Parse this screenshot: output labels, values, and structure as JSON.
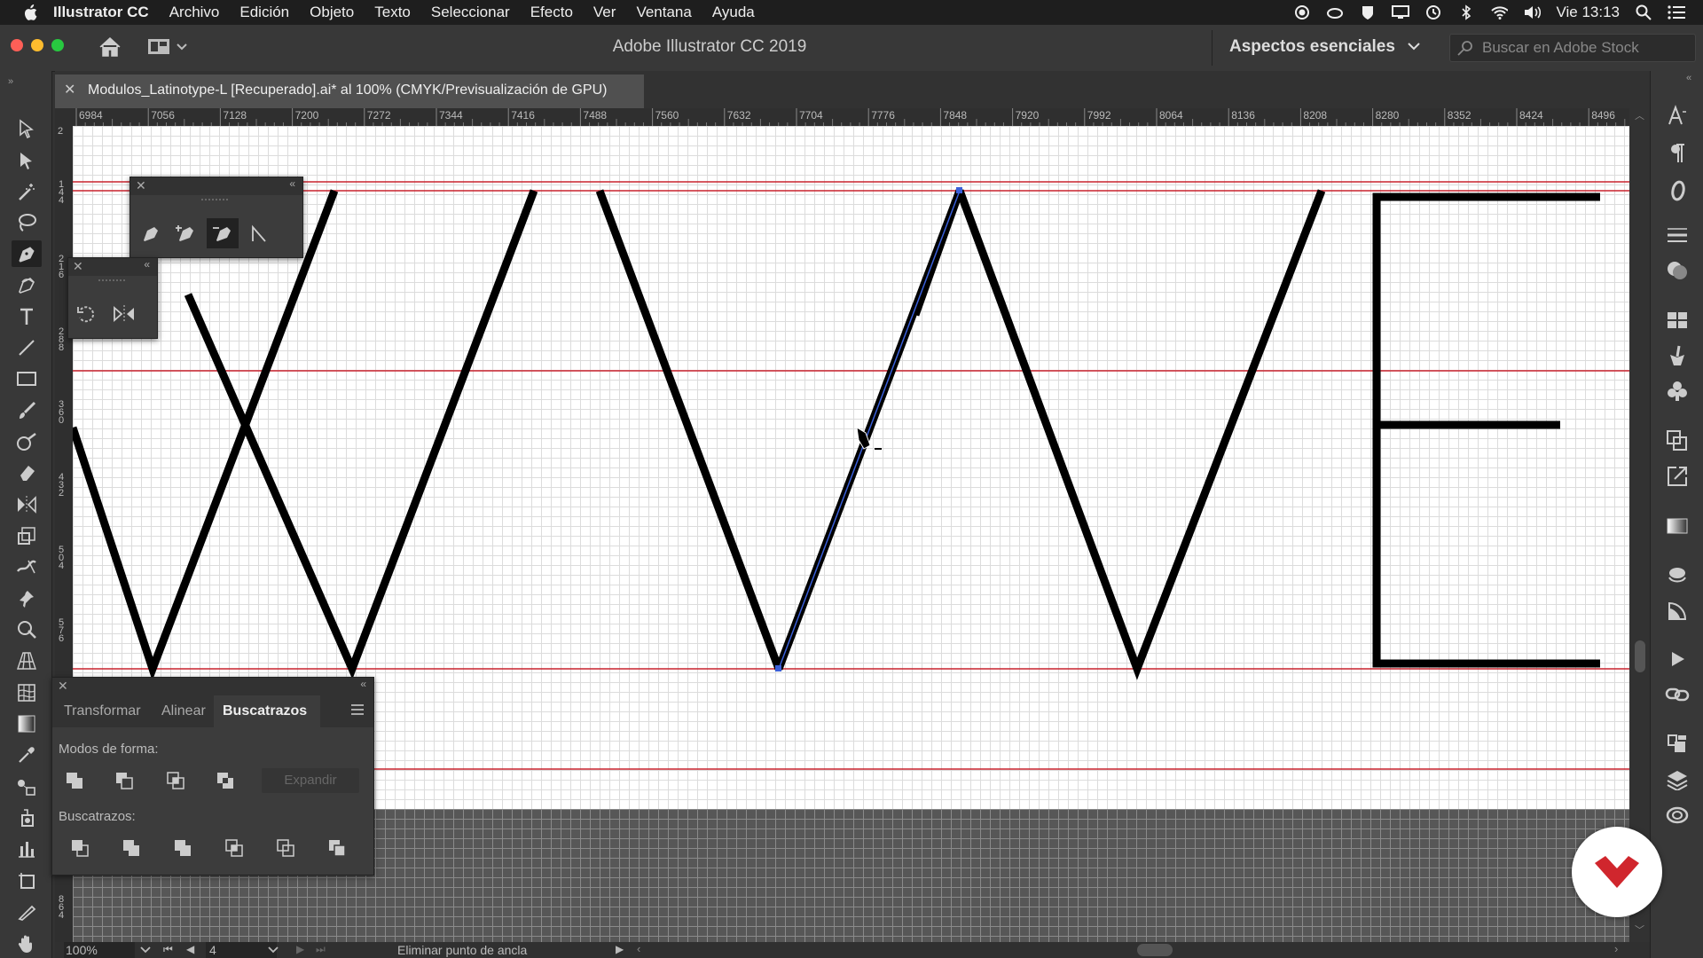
{
  "menubar": {
    "app_name": "Illustrator CC",
    "items": [
      "Archivo",
      "Edición",
      "Objeto",
      "Texto",
      "Seleccionar",
      "Efecto",
      "Ver",
      "Ventana",
      "Ayuda"
    ],
    "clock": "Vie 13:13"
  },
  "appbar": {
    "title": "Adobe Illustrator CC 2019",
    "workspace": "Aspectos esenciales",
    "stock_placeholder": "Buscar en Adobe Stock"
  },
  "document": {
    "tab_title": "Modulos_Latinotype-L [Recuperado].ai* al 100% (CMYK/Previsualización de GPU)"
  },
  "ruler": {
    "h_ticks": [
      "6984",
      "7056",
      "7128",
      "7200",
      "7272",
      "7344",
      "7416",
      "7488",
      "7560",
      "7632",
      "7704",
      "7776",
      "7848",
      "7920",
      "7992",
      "8064",
      "8136",
      "8208",
      "8280",
      "8352",
      "8424",
      "8496"
    ],
    "v_ticks": [
      "2",
      "1 4 4",
      "2 1 6",
      "2 8 8",
      "3 6 0",
      "4 3 2",
      "5 0 4",
      "5 7 6",
      "6 4 8",
      "8 6 4"
    ]
  },
  "pathfinder_panel": {
    "tabs": [
      "Transformar",
      "Alinear",
      "Buscatrazos"
    ],
    "active_tab": "Buscatrazos",
    "shape_modes_label": "Modos de forma:",
    "expand_label": "Expandir",
    "pathfinders_label": "Buscatrazos:"
  },
  "status": {
    "zoom": "100%",
    "artboard": "4",
    "tool_hint": "Eliminar punto de ancla"
  },
  "colors": {
    "guide": "#c8222d",
    "selection": "#3a5fd9",
    "brand": "#d0262d"
  }
}
